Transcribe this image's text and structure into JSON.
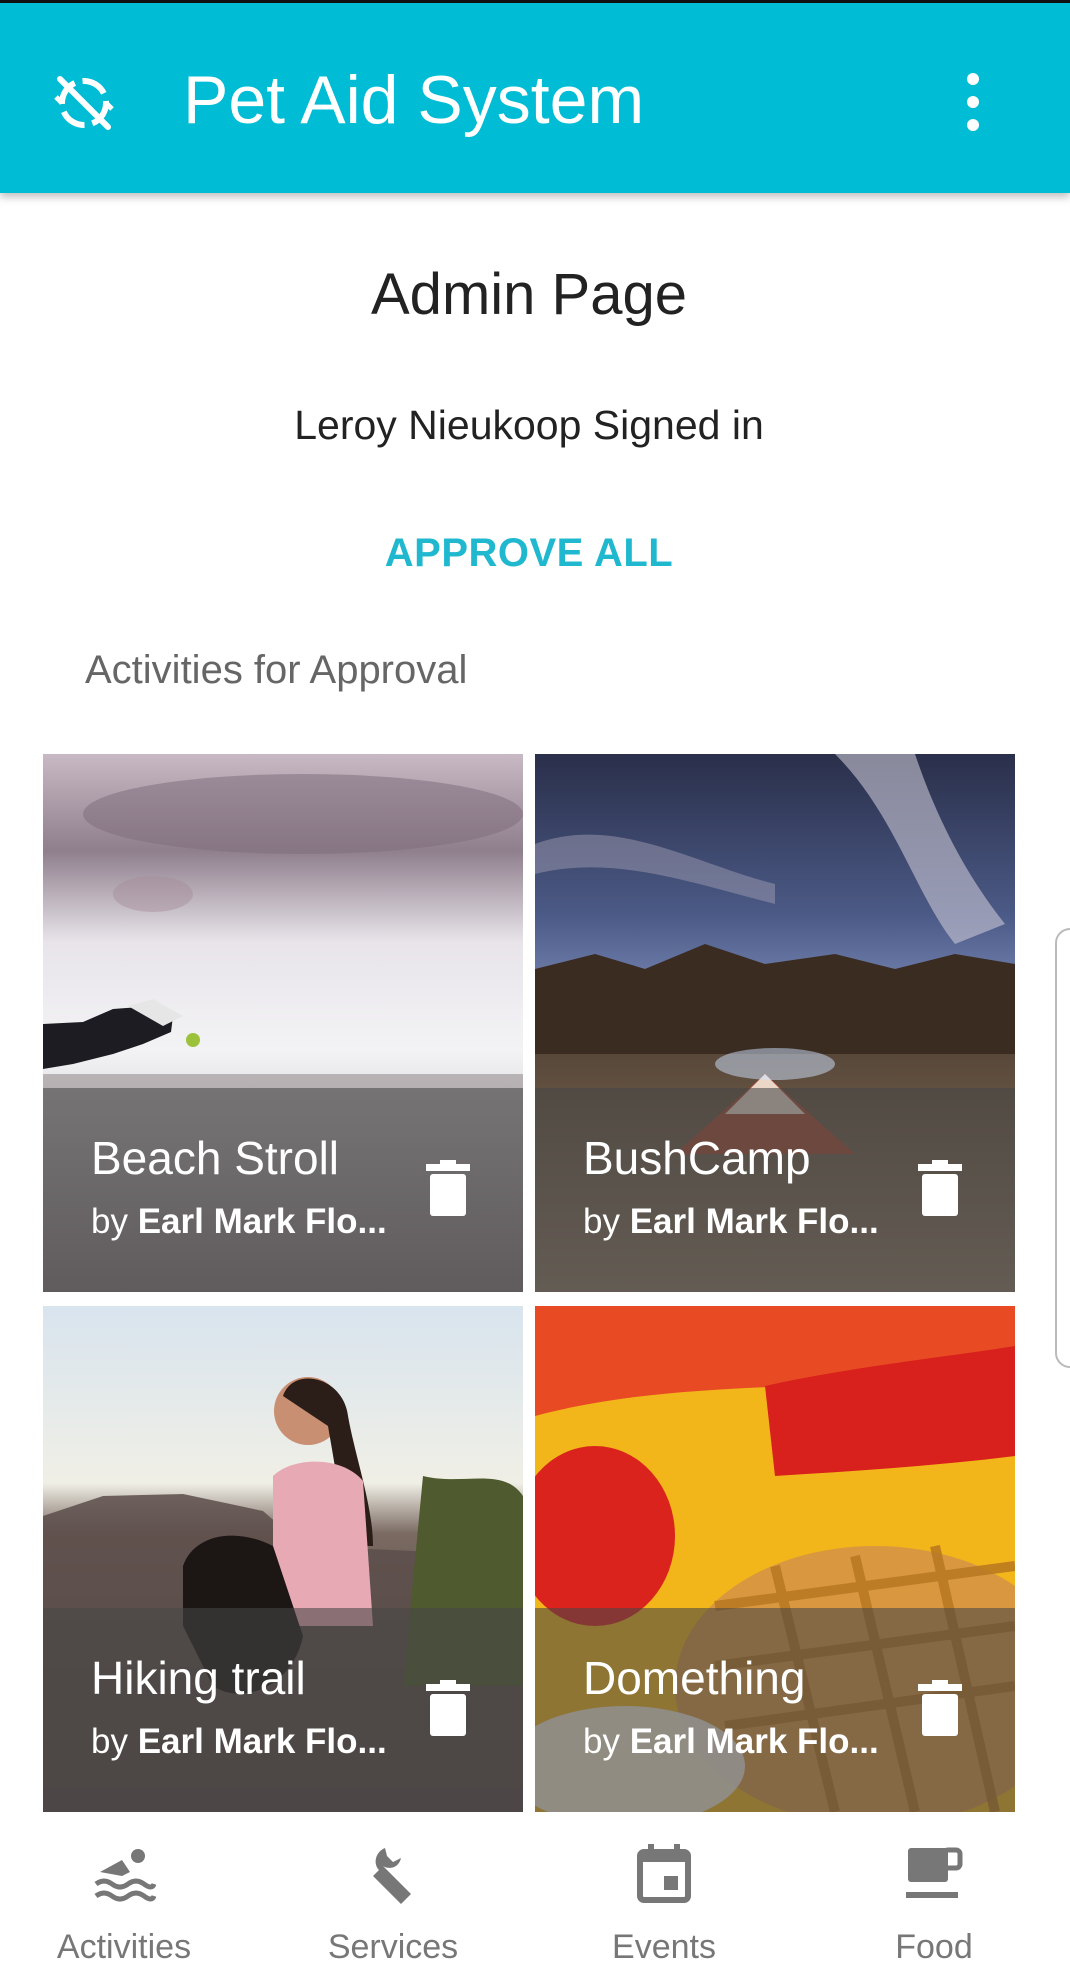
{
  "appbar": {
    "title": "Pet Aid System",
    "icon": "sync-disabled-icon",
    "color": "#00bcd4"
  },
  "main": {
    "heading": "Admin Page",
    "signed_in": "Leroy Nieukoop Signed in",
    "approve_all": "APPROVE ALL",
    "section_label": "Activities for Approval"
  },
  "activities": [
    {
      "name": "Beach Stroll",
      "by": "by ",
      "author": "Earl Mark Flo..."
    },
    {
      "name": "BushCamp",
      "by": "by ",
      "author": "Earl Mark Flo..."
    },
    {
      "name": "Hiking trail",
      "by": "by ",
      "author": "Earl Mark Flo..."
    },
    {
      "name": "Domething",
      "by": "by ",
      "author": "Earl Mark Flo..."
    }
  ],
  "nav": {
    "items": [
      {
        "label": "Activities",
        "icon": "swimmer-icon"
      },
      {
        "label": "Services",
        "icon": "wrench-icon"
      },
      {
        "label": "Events",
        "icon": "calendar-icon"
      },
      {
        "label": "Food",
        "icon": "coffee-cup-icon"
      }
    ]
  }
}
